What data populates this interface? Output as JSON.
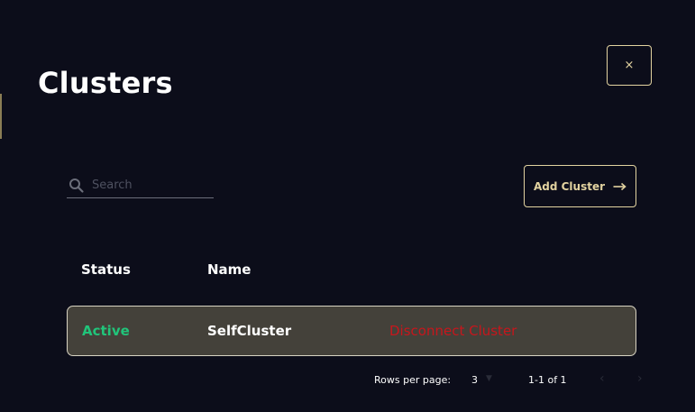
{
  "header": {
    "title": "Clusters",
    "close_label": "×"
  },
  "search": {
    "placeholder": "Search",
    "value": ""
  },
  "toolbar": {
    "add_label": "Add Cluster"
  },
  "table": {
    "columns": [
      "Status",
      "Name"
    ],
    "rows": [
      {
        "status": "Active",
        "name": "SelfCluster",
        "action": "Disconnect Cluster"
      }
    ]
  },
  "pagination": {
    "rows_per_page_label": "Rows per page:",
    "rows_per_page": "3",
    "range": "1-1 of 1"
  },
  "colors": {
    "background": "#0c0d1a",
    "accent": "#e3d3a0",
    "status_active": "#21c47a",
    "danger": "#c7161c",
    "row_background": "#44413a"
  },
  "icons": {
    "search": "search-icon",
    "close": "close-icon",
    "add_arrow": "arrow-right-icon",
    "rows_dropdown": "caret-down-icon",
    "prev": "chevron-left-icon",
    "next": "chevron-right-icon"
  }
}
